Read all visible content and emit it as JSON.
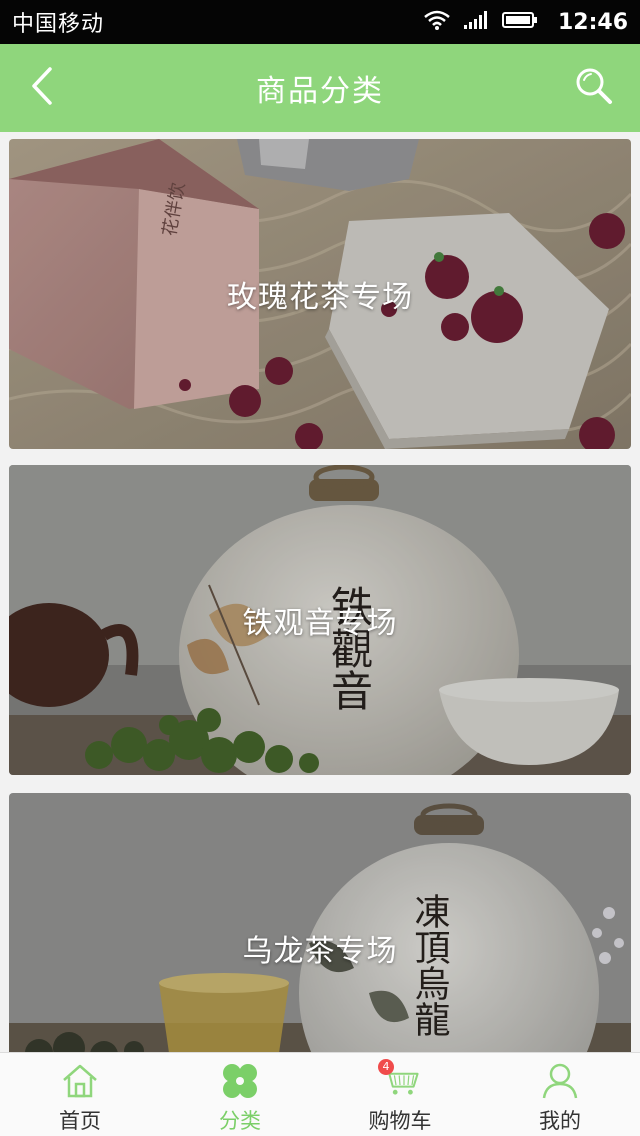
{
  "status_bar": {
    "carrier": "中国移动",
    "time": "12:46",
    "icons": [
      "wifi-icon",
      "signal-icon",
      "battery-icon"
    ]
  },
  "header": {
    "title": "商品分类",
    "back_icon": "chevron-left-icon",
    "search_icon": "search-icon",
    "background_color": "#8fd67c"
  },
  "categories": [
    {
      "label": "玫瑰花茶专场",
      "image": "rose-tea-photo",
      "box_text": "花伴饮"
    },
    {
      "label": "铁观音专场",
      "image": "tieguanyin-jar-photo",
      "jar_text": "铁觀音"
    },
    {
      "label": "乌龙茶专场",
      "image": "oolong-jar-photo",
      "jar_text": "凍頂烏龍"
    }
  ],
  "bottom_nav": {
    "items": [
      {
        "label": "首页",
        "icon": "home-icon",
        "active": false
      },
      {
        "label": "分类",
        "icon": "category-grid-icon",
        "active": true
      },
      {
        "label": "购物车",
        "icon": "cart-icon",
        "active": false,
        "badge": "4"
      },
      {
        "label": "我的",
        "icon": "user-icon",
        "active": false
      }
    ],
    "active_color": "#7bcf68"
  }
}
